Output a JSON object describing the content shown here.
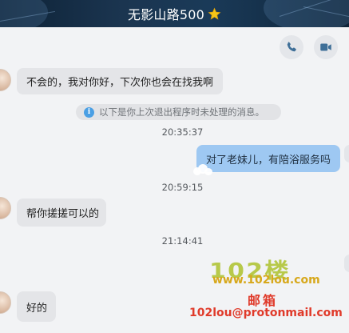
{
  "header": {
    "title": "无影山路500",
    "badge_icon": "star-icon"
  },
  "toolbar": {
    "voice_call_icon": "phone-icon",
    "video_call_icon": "video-camera-icon"
  },
  "notice": {
    "icon": "info-icon",
    "icon_glyph": "i",
    "text": "以下是你上次退出程序时未处理的消息。"
  },
  "messages": [
    {
      "direction": "in",
      "text": "不会的，我对你好，下次你也会在找我啊"
    },
    {
      "direction": "time",
      "text": "20:35:37"
    },
    {
      "direction": "out",
      "text": "对了老妹儿，有陪浴服务吗"
    },
    {
      "direction": "time",
      "text": "20:59:15"
    },
    {
      "direction": "in",
      "text": "帮你搓搓可以的"
    },
    {
      "direction": "time",
      "text": "21:14:41"
    },
    {
      "direction": "in",
      "text": "好的"
    }
  ],
  "watermark": {
    "title": "102楼",
    "site": "www.102lou.com",
    "mail_label": "邮箱",
    "email": "102lou@protonmail.com"
  },
  "colors": {
    "title_bar": "#142a40",
    "incoming_bubble": "#e4e5e8",
    "outgoing_bubble": "#9ec8f2",
    "chat_background": "#f2f3f5",
    "star": "#f5c518"
  }
}
